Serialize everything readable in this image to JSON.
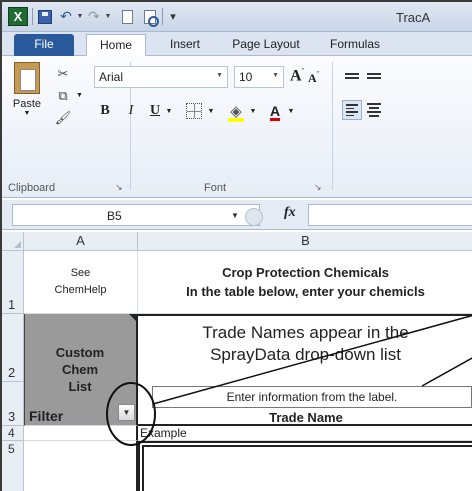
{
  "window": {
    "title": "TracA",
    "app_icon": "excel-icon",
    "quick_access": [
      "save-icon",
      "undo-icon",
      "redo-icon",
      "new-icon",
      "print-preview-icon"
    ]
  },
  "tabs": [
    {
      "label": "File"
    },
    {
      "label": "Home"
    },
    {
      "label": "Insert"
    },
    {
      "label": "Page Layout"
    },
    {
      "label": "Formulas"
    }
  ],
  "ribbon": {
    "clipboard": {
      "paste_label": "Paste",
      "group_label": "Clipboard"
    },
    "font": {
      "name": "Arial",
      "size": "10",
      "bold": "B",
      "italic": "I",
      "underline": "U",
      "font_color_letter": "A",
      "grow_letter": "A",
      "shrink_letter": "A",
      "group_label": "Font"
    }
  },
  "formula_bar": {
    "name_box": "B5",
    "fx_label": "fx",
    "formula": ""
  },
  "sheet": {
    "columns": [
      "A",
      "B"
    ],
    "rows": [
      "1",
      "2",
      "3",
      "4",
      "5"
    ],
    "a1": [
      "See",
      "ChemHelp"
    ],
    "b1": [
      "Crop Protection Chemicals",
      "In the table below, enter your chemicls"
    ],
    "custom_chem_list": [
      "Custom",
      "Chem",
      "List"
    ],
    "filter_label": "Filter",
    "b2": [
      "Trade Names appear in the",
      "SprayData drop-down list"
    ],
    "b3_box": "Enter information from the label.",
    "b3_header": "Trade Name",
    "b4": "Example",
    "colors": {
      "custom_list_fill": "#9a9a9a",
      "file_tab": "#2a5a9c"
    }
  }
}
